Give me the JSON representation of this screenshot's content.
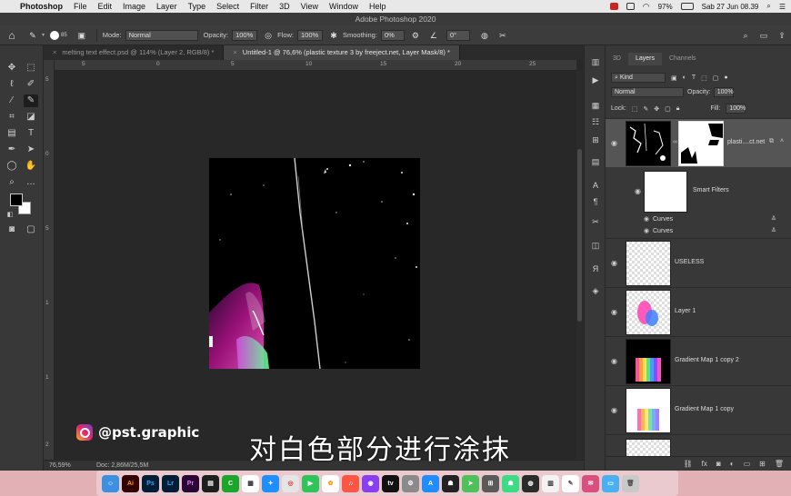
{
  "menubar": {
    "app": "Photoshop",
    "items": [
      "File",
      "Edit",
      "Image",
      "Layer",
      "Type",
      "Select",
      "Filter",
      "3D",
      "View",
      "Window",
      "Help"
    ],
    "battery": "97%",
    "datetime": "Sab 27 Jun  08.39"
  },
  "window_title": "Adobe Photoshop 2020",
  "options": {
    "brush_size": "85",
    "mode_label": "Mode:",
    "mode_value": "Normal",
    "opacity_label": "Opacity:",
    "opacity_value": "100%",
    "flow_label": "Flow:",
    "flow_value": "100%",
    "smoothing_label": "Smoothing:",
    "smoothing_value": "0%",
    "angle_value": "0°"
  },
  "tabs": [
    {
      "label": "melting text effect.psd @ 114% (Layer 2, RGB/8) *",
      "active": false
    },
    {
      "label": "Untitled-1 @ 76,6% (plastic texture 3 by freeject.net, Layer Mask/8) *",
      "active": true
    }
  ],
  "ruler_top": [
    "5",
    "0",
    "5",
    "10",
    "15",
    "20",
    "25"
  ],
  "ruler_left": [
    "5",
    "0",
    "5",
    "1",
    "1",
    "2"
  ],
  "status": {
    "zoom": "76,59%",
    "doc": "Doc: 2,86M/25,5M"
  },
  "panel": {
    "tabs": [
      "3D",
      "Layers",
      "Channels"
    ],
    "kind_label": "Kind",
    "blend_mode": "Normal",
    "opacity_label": "Opacity:",
    "opacity_value": "100%",
    "lock_label": "Lock:",
    "fill_label": "Fill:",
    "fill_value": "100%",
    "layers": [
      {
        "name": "plasti....ct.net",
        "type": "smart-with-mask",
        "selected": true
      },
      {
        "name": "Smart Filters",
        "type": "filter-mask"
      },
      {
        "name": "Curves",
        "type": "filter"
      },
      {
        "name": "Curves",
        "type": "filter"
      },
      {
        "name": "USELESS",
        "type": "transparent"
      },
      {
        "name": "Layer 1",
        "type": "colorful"
      },
      {
        "name": "Gradient Map 1 copy 2",
        "type": "gradient-dark"
      },
      {
        "name": "Gradient Map 1 copy",
        "type": "gradient-light"
      }
    ]
  },
  "overlay": {
    "watermark": "@pst.graphic",
    "subtitle": "对白色部分进行涂抹"
  },
  "dock_icons": [
    "finder",
    "illustrator",
    "photoshop",
    "lightroom",
    "premiere",
    "media-encoder",
    "green-app",
    "calendar",
    "safari",
    "chrome",
    "facetime",
    "photos",
    "music",
    "podcasts",
    "tv",
    "system-prefs",
    "app-store",
    "game",
    "maps",
    "launchpad",
    "android",
    "obs",
    "preview",
    "textedit",
    "mail",
    "folder",
    "trash"
  ]
}
